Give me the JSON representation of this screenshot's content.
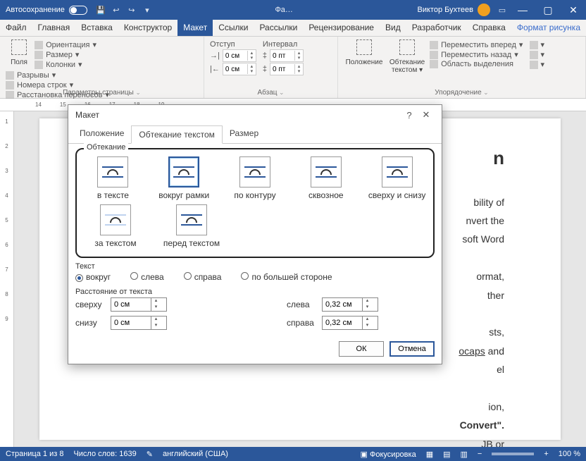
{
  "titlebar": {
    "autosave": "Автосохранение",
    "doc_short": "Фа…",
    "user": "Виктор Бухтеев"
  },
  "menu": {
    "file": "Файл",
    "home": "Главная",
    "insert": "Вставка",
    "design": "Конструктор",
    "layout": "Макет",
    "references": "Ссылки",
    "mailings": "Рассылки",
    "review": "Рецензирование",
    "view": "Вид",
    "developer": "Разработчик",
    "help": "Справка",
    "format_picture": "Формат рисунка"
  },
  "ribbon": {
    "margins": "Поля",
    "orientation": "Ориентация",
    "size": "Размер",
    "columns": "Колонки",
    "breaks": "Разрывы",
    "line_numbers": "Номера строк",
    "hyphenation": "Расстановка переносов",
    "group_page": "Параметры страницы",
    "indent_label": "Отступ",
    "spacing_label": "Интервал",
    "indent_left": "0 см",
    "indent_right": "0 см",
    "spacing_before": "0 пт",
    "spacing_after": "0 пт",
    "group_paragraph": "Абзац",
    "position": "Положение",
    "wrap_text": "Обтекание текстом",
    "bring_forward": "Переместить вперед",
    "send_backward": "Переместить назад",
    "selection_pane": "Область выделения",
    "group_arrange": "Упорядочение"
  },
  "dialog": {
    "title": "Макет",
    "tab_position": "Положение",
    "tab_wrap": "Обтекание текстом",
    "tab_size": "Размер",
    "group_wrap": "Обтекание",
    "wrap_inline": "в тексте",
    "wrap_square": "вокруг рамки",
    "wrap_tight": "по контуру",
    "wrap_through": "сквозное",
    "wrap_topbottom": "сверху и снизу",
    "wrap_behind": "за текстом",
    "wrap_front": "перед текстом",
    "text_label": "Текст",
    "around": "вокруг",
    "left": "слева",
    "right": "справа",
    "largest": "по большей стороне",
    "distance_label": "Расстояние от текста",
    "top": "сверху",
    "bottom": "снизу",
    "d_left": "слева",
    "d_right": "справа",
    "top_val": "0 см",
    "bottom_val": "0 см",
    "left_val": "0,32 см",
    "right_val": "0,32 см",
    "ok": "ОК",
    "cancel": "Отмена"
  },
  "doc": {
    "heading_suffix": "n",
    "l1": "bility of",
    "l2": "nvert the",
    "l3": "soft Word",
    "l4": "ormat,",
    "l5": "ther",
    "l6": "sts,",
    "l7a": "ocaps",
    "l7b": " and",
    "l8": "el",
    "l9": "ion,",
    "l10": "Convert\".",
    "l11": "JB or"
  },
  "status": {
    "page": "Страница 1 из 8",
    "words": "Число слов: 1639",
    "lang": "английский (США)",
    "focus": "Фокусировка",
    "zoom": "100 %"
  }
}
